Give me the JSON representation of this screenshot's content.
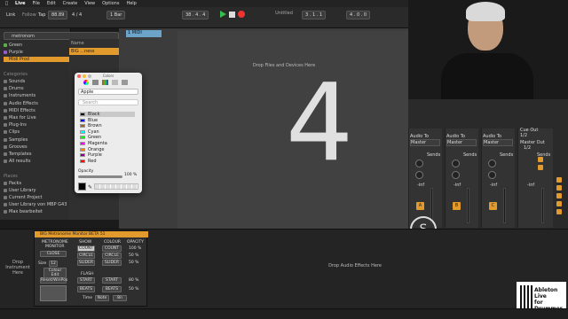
{
  "menubar": {
    "apple": "",
    "app": "Live",
    "items": [
      "Live",
      "File",
      "Edit",
      "Create",
      "View",
      "Options",
      "Help"
    ]
  },
  "window_title": "Untitled",
  "transport": {
    "link": "Link",
    "follow": "Follow",
    "tap": "Tap",
    "tempo": "88.89",
    "meter": "4 / 4",
    "bar": "1 Bar",
    "position": "38 . 4 . 4",
    "loop_start": "3 . 1 . 1",
    "loop_len": "4 . 0 . 0"
  },
  "browser": {
    "search_value": "metronom",
    "collections": [
      {
        "label": "Green",
        "color": "#5ab14a"
      },
      {
        "label": "Purple",
        "color": "#9b59d0"
      },
      {
        "label": "Midi Prod",
        "color": "#e39a2c"
      }
    ],
    "categories_header": "Categories",
    "categories": [
      "Sounds",
      "Drums",
      "Instruments",
      "Audio Effects",
      "MIDI Effects",
      "Max for Live",
      "Plug-Ins",
      "Clips",
      "Samples",
      "Grooves",
      "Templates",
      "All results"
    ],
    "places_header": "Places",
    "places": [
      "Packs",
      "User Library",
      "Current Project",
      "User Library von MBP G43",
      "Max bearbeitet"
    ],
    "file_header": "Name",
    "file_item": "BiG ...ness"
  },
  "tracks": {
    "midi_track": "1 MIDI",
    "drop_files": "Drop Files and Devices Here",
    "big_number": "4"
  },
  "mixer": {
    "audio_to_labels": [
      "Audio To",
      "Audio To",
      "Audio To",
      "Cue Out"
    ],
    "master_labels": [
      "Master",
      "Master",
      "Master",
      "1/2"
    ],
    "master_out": "Master Out",
    "master_out_value": "1/2",
    "sends": [
      "Sends",
      "Sends",
      "Sends",
      "Sends"
    ],
    "inf": [
      "-inf",
      "-inf",
      "-inf",
      "-inf"
    ],
    "clip_buttons": [
      "A",
      "B",
      "C"
    ],
    "s_button": "S"
  },
  "color_panel": {
    "title": "Colors",
    "palette_label": "Apple",
    "search_placeholder": "Search",
    "colors": [
      {
        "name": "Black",
        "hex": "#000000"
      },
      {
        "name": "Blue",
        "hex": "#0000ff"
      },
      {
        "name": "Brown",
        "hex": "#996633"
      },
      {
        "name": "Cyan",
        "hex": "#00ffff"
      },
      {
        "name": "Green",
        "hex": "#00ff00"
      },
      {
        "name": "Magenta",
        "hex": "#ff00ff"
      },
      {
        "name": "Orange",
        "hex": "#ff8000"
      },
      {
        "name": "Purple",
        "hex": "#800080"
      },
      {
        "name": "Red",
        "hex": "#ff0000"
      }
    ],
    "opacity_label": "Opacity",
    "opacity_value": "100 %"
  },
  "device": {
    "title": "BIG Metronome Monitor BETA 51",
    "name_line1": "METRONOME",
    "name_line2": "MONITOR",
    "close": "CLOSE",
    "size_label": "Size",
    "size_value": "12",
    "colour_edit": "Colour Edit",
    "reset": "Reset/WinPos",
    "show_header": "SHOW",
    "colour_header": "COLOUR",
    "opacity_header": "OPACITY",
    "show_items": [
      "COUNT",
      "CIRCLE",
      "SLIDER"
    ],
    "colour_items": [
      "COUNT",
      "CIRCLE",
      "SLIDER"
    ],
    "opacity_items": [
      "100 %",
      "50 %",
      "50 %"
    ],
    "flash_header": "FLASH",
    "flash_items": [
      "START",
      "BEATS"
    ],
    "flash_colour": [
      "START",
      "BEATS"
    ],
    "flash_opacity": [
      "80 %",
      "50 %"
    ],
    "time_label": "Time",
    "time_value": "Note",
    "time_div": "8n"
  },
  "drop_instrument": "Drop Instrument Here",
  "drop_effects": "Drop Audio Effects Here",
  "logo": {
    "line1": "Ableton Live",
    "line2": "for Drummer"
  },
  "accent_color": "#e39a2c",
  "midi_color": "#6ba3c9"
}
